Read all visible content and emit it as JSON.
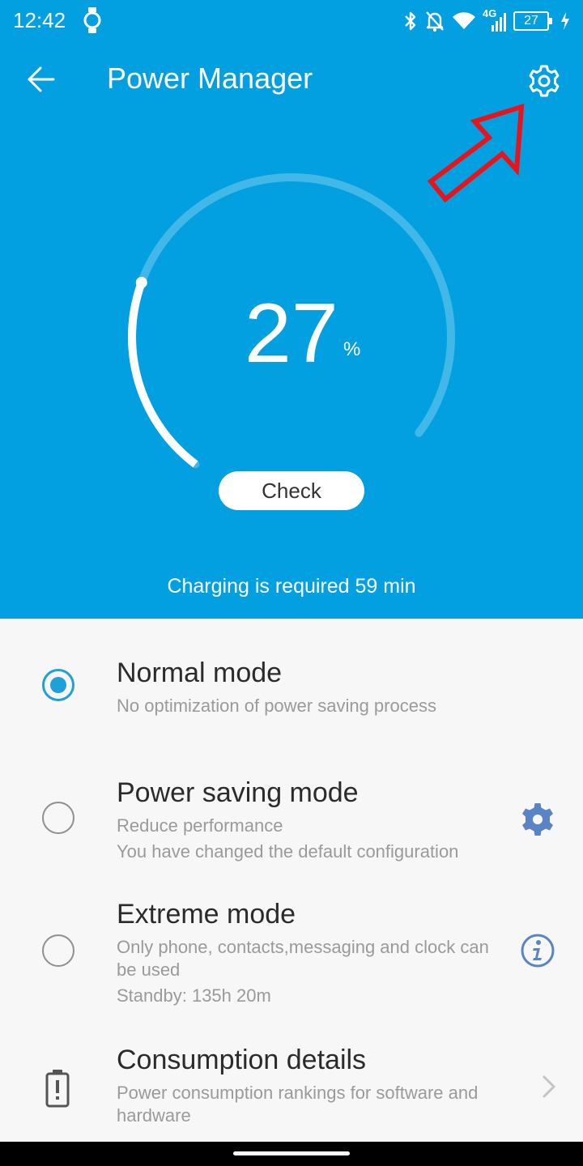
{
  "status_bar": {
    "time": "12:42",
    "network": "4G",
    "battery_level": "27",
    "icons": [
      "watch-icon",
      "bluetooth-icon",
      "notifications-off-icon",
      "wifi-icon",
      "cell-signal-icon",
      "battery-icon",
      "charging-bolt-icon"
    ]
  },
  "toolbar": {
    "title": "Power Manager",
    "back_icon": "arrow-left-icon",
    "settings_icon": "gear-icon"
  },
  "gauge": {
    "value": "27",
    "unit": "%",
    "fraction": 0.27
  },
  "check_button": {
    "label": "Check"
  },
  "charging_text": "Charging is required 59 min",
  "modes": {
    "normal": {
      "title": "Normal mode",
      "desc": "No optimization of power saving process",
      "selected": true
    },
    "power_saving": {
      "title": "Power saving mode",
      "desc1": "Reduce performance",
      "desc2": "You have changed the default configuration",
      "selected": false,
      "action_icon": "gear-icon"
    },
    "extreme": {
      "title": "Extreme mode",
      "desc1": "Only phone, contacts,messaging and clock can be used",
      "desc2": "Standby: 135h 20m",
      "selected": false,
      "action_icon": "info-icon"
    },
    "consumption": {
      "title": "Consumption details",
      "desc": "Power consumption rankings for software and hardware",
      "icon": "battery-alert-icon",
      "action_icon": "chevron-right-icon"
    }
  },
  "colors": {
    "primary": "#03a0e1",
    "accent": "#1da1d6",
    "icon_blue": "#5b84c4",
    "annotation": "#e8141c"
  }
}
